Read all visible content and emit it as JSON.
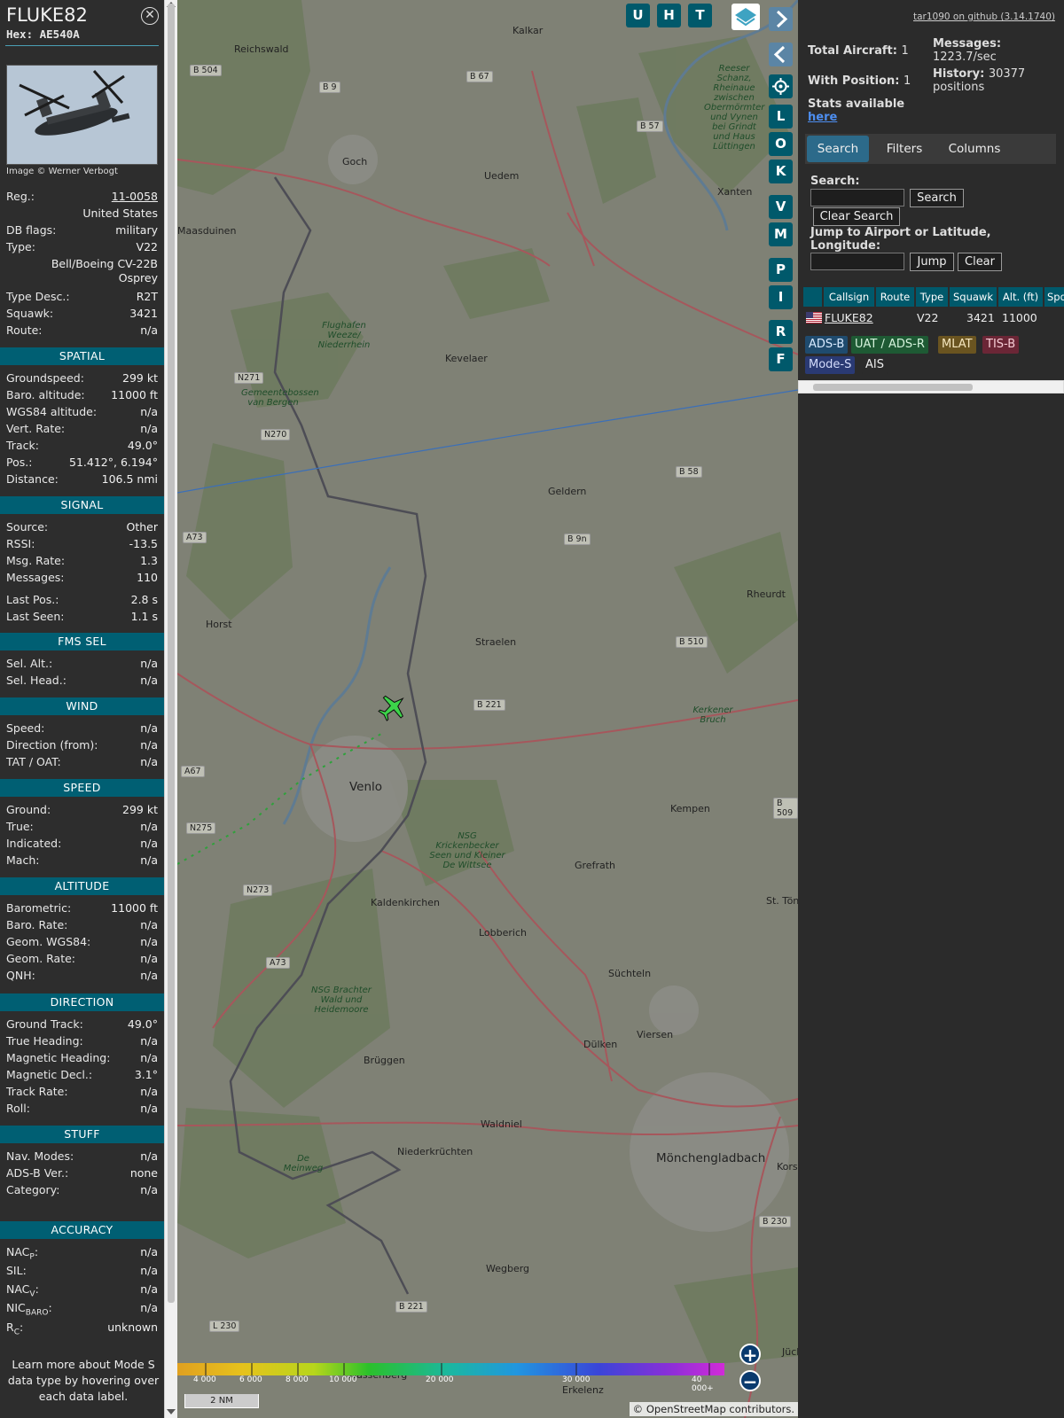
{
  "aircraft": {
    "callsign": "FLUKE82",
    "hex": "Hex: AE540A",
    "photo_credit": "Image © Werner Verbogt",
    "reg_label": "Reg.:",
    "reg_value": "11-0058",
    "country": "United States",
    "dbflags_label": "DB flags:",
    "dbflags_value": "military",
    "type_label": "Type:",
    "type_value": "V22",
    "type_name_1": "Bell/Boeing CV-22B",
    "type_name_2": "Osprey",
    "typedesc_label": "Type Desc.:",
    "typedesc_value": "R2T",
    "squawk_label": "Squawk:",
    "squawk_value": "3421",
    "route_label": "Route:",
    "route_value": "n/a"
  },
  "sections": {
    "spatial": "SPATIAL",
    "signal": "SIGNAL",
    "fmssel": "FMS SEL",
    "wind": "WIND",
    "speed": "SPEED",
    "altitude": "ALTITUDE",
    "direction": "DIRECTION",
    "stuff": "STUFF",
    "accuracy": "ACCURACY"
  },
  "spatial": [
    {
      "label": "Groundspeed:",
      "value": "299 kt"
    },
    {
      "label": "Baro. altitude:",
      "value": "11000 ft"
    },
    {
      "label": "WGS84 altitude:",
      "value": "n/a"
    },
    {
      "label": "Vert. Rate:",
      "value": "n/a"
    },
    {
      "label": "Track:",
      "value": "49.0°"
    },
    {
      "label": "Pos.:",
      "value": "51.412°, 6.194°"
    },
    {
      "label": "Distance:",
      "value": "106.5 nmi"
    }
  ],
  "signal": [
    {
      "label": "Source:",
      "value": "Other"
    },
    {
      "label": "RSSI:",
      "value": "-13.5"
    },
    {
      "label": "Msg. Rate:",
      "value": "1.3"
    },
    {
      "label": "Messages:",
      "value": "110"
    },
    {
      "label": "Last Pos.:",
      "value": "2.8 s"
    },
    {
      "label": "Last Seen:",
      "value": "1.1 s"
    }
  ],
  "fmssel": [
    {
      "label": "Sel. Alt.:",
      "value": "n/a"
    },
    {
      "label": "Sel. Head.:",
      "value": "n/a"
    }
  ],
  "wind": [
    {
      "label": "Speed:",
      "value": "n/a"
    },
    {
      "label": "Direction (from):",
      "value": "n/a"
    },
    {
      "label": "TAT / OAT:",
      "value": "n/a"
    }
  ],
  "speed": [
    {
      "label": "Ground:",
      "value": "299 kt"
    },
    {
      "label": "True:",
      "value": "n/a"
    },
    {
      "label": "Indicated:",
      "value": "n/a"
    },
    {
      "label": "Mach:",
      "value": "n/a"
    }
  ],
  "altitude": [
    {
      "label": "Barometric:",
      "value": "11000 ft"
    },
    {
      "label": "Baro. Rate:",
      "value": "n/a"
    },
    {
      "label": "Geom. WGS84:",
      "value": "n/a"
    },
    {
      "label": "Geom. Rate:",
      "value": "n/a"
    },
    {
      "label": "QNH:",
      "value": "n/a"
    }
  ],
  "direction": [
    {
      "label": "Ground Track:",
      "value": "49.0°"
    },
    {
      "label": "True Heading:",
      "value": "n/a"
    },
    {
      "label": "Magnetic Heading:",
      "value": "n/a"
    },
    {
      "label": "Magnetic Decl.:",
      "value": "3.1°"
    },
    {
      "label": "Track Rate:",
      "value": "n/a"
    },
    {
      "label": "Roll:",
      "value": "n/a"
    }
  ],
  "stuff": [
    {
      "label": "Nav. Modes:",
      "value": "n/a"
    },
    {
      "label": "ADS-B Ver.:",
      "value": "none"
    },
    {
      "label": "Category:",
      "value": "n/a"
    }
  ],
  "accuracy": [
    {
      "label": "NAC",
      "sub": "P",
      "suffix": ":",
      "value": "n/a"
    },
    {
      "label": "SIL:",
      "sub": "",
      "suffix": "",
      "value": "n/a"
    },
    {
      "label": "NAC",
      "sub": "V",
      "suffix": ":",
      "value": "n/a"
    },
    {
      "label": "NIC",
      "sub": "BARO",
      "suffix": ":",
      "value": "n/a"
    },
    {
      "label": "R",
      "sub": "C",
      "suffix": ":",
      "value": "unknown"
    }
  ],
  "learn_more": "Learn more about Mode S data type by hovering over each data label.",
  "map": {
    "buttons_top": [
      "U",
      "H",
      "T"
    ],
    "buttons_side": [
      "L",
      "O",
      "K",
      "V",
      "M",
      "P",
      "I",
      "R",
      "F"
    ],
    "places": [
      {
        "name": "Kalkar"
      },
      {
        "name": "Goch"
      },
      {
        "name": "Uedem"
      },
      {
        "name": "Xanten"
      },
      {
        "name": "Kevelaer"
      },
      {
        "name": "Geldern"
      },
      {
        "name": "Straelen"
      },
      {
        "name": "Rheurdt"
      },
      {
        "name": "Horst"
      },
      {
        "name": "Venlo"
      },
      {
        "name": "Kempen"
      },
      {
        "name": "Grefrath"
      },
      {
        "name": "Kaldenkirchen"
      },
      {
        "name": "Lobberich"
      },
      {
        "name": "St. Tönis"
      },
      {
        "name": "Süchteln"
      },
      {
        "name": "Viersen"
      },
      {
        "name": "Dülken"
      },
      {
        "name": "Brüggen"
      },
      {
        "name": "Waldniel"
      },
      {
        "name": "Niederkrüchten"
      },
      {
        "name": "Mönchengladbach"
      },
      {
        "name": "Wegberg"
      },
      {
        "name": "Wassenberg"
      },
      {
        "name": "Erkelenz"
      },
      {
        "name": "Maasduinen"
      },
      {
        "name": "Reichswald"
      },
      {
        "name": "Kors"
      },
      {
        "name": "Jüch"
      }
    ],
    "areas": [
      {
        "name": "Flughafen Weeze/ Niederrhein"
      },
      {
        "name": "Gemeentebossen van Bergen"
      },
      {
        "name": "Reeser Schanz, Rheinaue zwischen Obermörmter und Vynen bei Grindt und Haus Lüttingen"
      },
      {
        "name": "Kerkener Bruch"
      },
      {
        "name": "NSG Krickenbecker Seen und Kleiner De Wittsee"
      },
      {
        "name": "NSG Brachter Wald und Heidemoore"
      },
      {
        "name": "De Meinweg"
      }
    ],
    "roads": [
      "B 504",
      "B 9",
      "B 67",
      "B 57",
      "N271",
      "N270",
      "B 58",
      "A73",
      "B 9n",
      "B 510",
      "B 221",
      "A67",
      "N275",
      "B 509",
      "N273",
      "A73",
      "B 221",
      "L 230",
      "B 230"
    ],
    "colorbar_ticks": [
      "4 000",
      "6 000",
      "8 000",
      "10 000",
      "20 000",
      "30 000",
      "40 000+"
    ],
    "scale": "2 NM",
    "zoom_in": "+",
    "zoom_out": "−",
    "attribution": "© OpenStreetMap contributors."
  },
  "sidebar": {
    "version_link": "tar1090 on github (3.14.1740)",
    "total_aircraft_label": "Total Aircraft:",
    "total_aircraft": "1",
    "with_position_label": "With Position:",
    "with_position": "1",
    "messages_label": "Messages:",
    "messages": "1223.7/sec",
    "history_label": "History:",
    "history": "30377 positions",
    "stats_label": "Stats available",
    "stats_link": "here",
    "tabs": [
      "Search",
      "Filters",
      "Columns"
    ],
    "search_label": "Search:",
    "search_button": "Search",
    "clear_search_button": "Clear Search",
    "jump_label": "Jump to Airport or Latitude, Longitude:",
    "jump_button": "Jump",
    "clear_button": "Clear",
    "table_headers": [
      "",
      "Callsign",
      "Route",
      "Type",
      "Squawk",
      "Alt. (ft)",
      "Spd"
    ],
    "table_row": {
      "callsign": "FLUKE82",
      "route": "",
      "type": "V22",
      "squawk": "3421",
      "alt": "11000"
    },
    "sources": [
      {
        "label": "ADS-B",
        "color": "#1f4b6e",
        "text": "#d8eaff"
      },
      {
        "label": "UAT / ADS-R",
        "color": "#1e5a34",
        "text": "#d5f3dc"
      },
      {
        "label": "MLAT",
        "color": "#6a5420",
        "text": "#f6e7bf"
      },
      {
        "label": "TIS-B",
        "color": "#6b2636",
        "text": "#f7cdd6"
      },
      {
        "label": "Mode-S",
        "color": "#2a3a74",
        "text": "#d4dcfb"
      },
      {
        "label": "AIS",
        "color": "#2b2b2b",
        "text": "#eeeeee"
      }
    ]
  },
  "colors": {
    "accent": "#005f73",
    "panel": "#2d2d2d",
    "aircraft": "#3cd44a",
    "track": "#2fa13b"
  }
}
